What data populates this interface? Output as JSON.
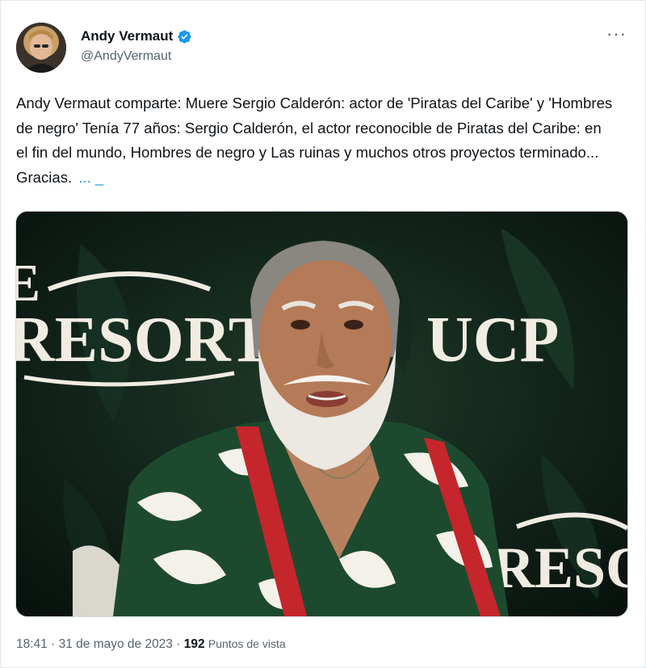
{
  "author": {
    "name": "Andy Vermaut",
    "handle": "@AndyVermaut",
    "verified": true
  },
  "tweet": {
    "text": "Andy Vermaut comparte: Muere Sergio Calderón: actor de 'Piratas del Caribe' y 'Hombres de negro' Tenía 77 años: Sergio Calderón, el actor reconocible de Piratas del Caribe: en el fin del mundo, Hombres de negro y Las ruinas y muchos otros proyectos terminado... Gracias.",
    "show_more": "... _"
  },
  "media": {
    "backdrop_logo_left": "RESORT",
    "backdrop_logo_left_partial": "E",
    "backdrop_logo_right": "UCP",
    "backdrop_logo_bottom": "RESORT"
  },
  "meta": {
    "time": "18:41",
    "separator": "·",
    "date": "31 de mayo de 2023",
    "views_count": "192",
    "views_label": "Puntos de vista"
  },
  "icons": [
    "avatar",
    "verified-badge-icon",
    "more-options-icon"
  ],
  "colors": {
    "link": "#1d9bf0",
    "secondary_text": "#536471",
    "primary_text": "#0f1419",
    "verified": "#1d9bf0"
  }
}
